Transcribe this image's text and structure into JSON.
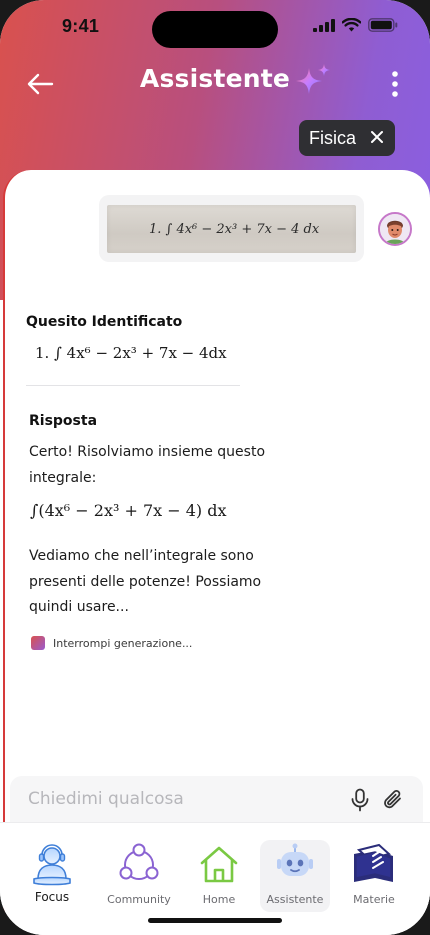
{
  "status_bar": {
    "time": "9:41"
  },
  "header": {
    "title": "Assistente",
    "subject_chip": "Fisica"
  },
  "conversation": {
    "user_photo_text": "1. ∫ 4x⁶ − 2x³ + 7x − 4 dx",
    "identified": {
      "title": "Quesito Identificato",
      "formula": "1. ∫ 4x⁶ − 2x³ + 7x − 4dx"
    },
    "answer": {
      "title": "Risposta",
      "intro": "Certo! Risolviamo insieme questo integrale:",
      "formula": "∫(4x⁶ − 2x³ + 7x − 4) dx",
      "body": "Vediamo che nell’integrale sono presenti delle potenze! Possiamo quindi usare..."
    },
    "stop_label": "Interrompi generazione..."
  },
  "input": {
    "placeholder": "Chiedimi qualcosa"
  },
  "bottom_nav": [
    {
      "label": "Focus",
      "icon": "focus-person-icon",
      "active": true
    },
    {
      "label": "Community",
      "icon": "community-icon"
    },
    {
      "label": "Home",
      "icon": "home-icon"
    },
    {
      "label": "Assistente",
      "icon": "robot-icon",
      "selected": true
    },
    {
      "label": "Materie",
      "icon": "books-icon"
    }
  ],
  "colors": {
    "gradient_start": "#d9514e",
    "gradient_end": "#8a5fe2",
    "chip_bg": "#2f2f33",
    "accent_purple": "#8a63d2",
    "home_green": "#7ac943"
  }
}
